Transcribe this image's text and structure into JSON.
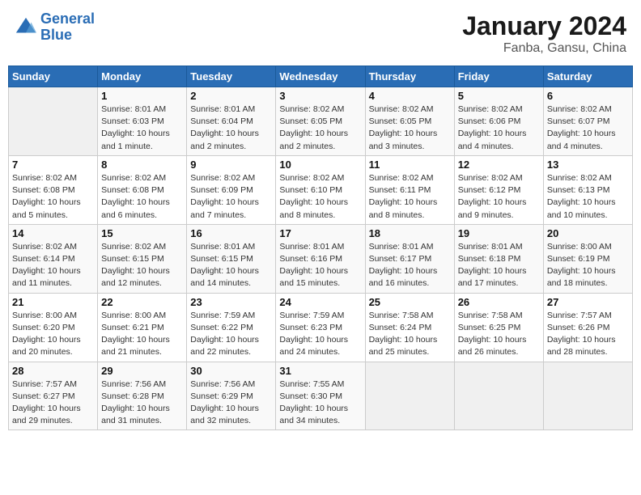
{
  "header": {
    "logo_line1": "General",
    "logo_line2": "Blue",
    "month": "January 2024",
    "location": "Fanba, Gansu, China"
  },
  "weekdays": [
    "Sunday",
    "Monday",
    "Tuesday",
    "Wednesday",
    "Thursday",
    "Friday",
    "Saturday"
  ],
  "weeks": [
    [
      {
        "day": "",
        "sunrise": "",
        "sunset": "",
        "daylight": ""
      },
      {
        "day": "1",
        "sunrise": "Sunrise: 8:01 AM",
        "sunset": "Sunset: 6:03 PM",
        "daylight": "Daylight: 10 hours and 1 minute."
      },
      {
        "day": "2",
        "sunrise": "Sunrise: 8:01 AM",
        "sunset": "Sunset: 6:04 PM",
        "daylight": "Daylight: 10 hours and 2 minutes."
      },
      {
        "day": "3",
        "sunrise": "Sunrise: 8:02 AM",
        "sunset": "Sunset: 6:05 PM",
        "daylight": "Daylight: 10 hours and 2 minutes."
      },
      {
        "day": "4",
        "sunrise": "Sunrise: 8:02 AM",
        "sunset": "Sunset: 6:05 PM",
        "daylight": "Daylight: 10 hours and 3 minutes."
      },
      {
        "day": "5",
        "sunrise": "Sunrise: 8:02 AM",
        "sunset": "Sunset: 6:06 PM",
        "daylight": "Daylight: 10 hours and 4 minutes."
      },
      {
        "day": "6",
        "sunrise": "Sunrise: 8:02 AM",
        "sunset": "Sunset: 6:07 PM",
        "daylight": "Daylight: 10 hours and 4 minutes."
      }
    ],
    [
      {
        "day": "7",
        "sunrise": "Sunrise: 8:02 AM",
        "sunset": "Sunset: 6:08 PM",
        "daylight": "Daylight: 10 hours and 5 minutes."
      },
      {
        "day": "8",
        "sunrise": "Sunrise: 8:02 AM",
        "sunset": "Sunset: 6:08 PM",
        "daylight": "Daylight: 10 hours and 6 minutes."
      },
      {
        "day": "9",
        "sunrise": "Sunrise: 8:02 AM",
        "sunset": "Sunset: 6:09 PM",
        "daylight": "Daylight: 10 hours and 7 minutes."
      },
      {
        "day": "10",
        "sunrise": "Sunrise: 8:02 AM",
        "sunset": "Sunset: 6:10 PM",
        "daylight": "Daylight: 10 hours and 8 minutes."
      },
      {
        "day": "11",
        "sunrise": "Sunrise: 8:02 AM",
        "sunset": "Sunset: 6:11 PM",
        "daylight": "Daylight: 10 hours and 8 minutes."
      },
      {
        "day": "12",
        "sunrise": "Sunrise: 8:02 AM",
        "sunset": "Sunset: 6:12 PM",
        "daylight": "Daylight: 10 hours and 9 minutes."
      },
      {
        "day": "13",
        "sunrise": "Sunrise: 8:02 AM",
        "sunset": "Sunset: 6:13 PM",
        "daylight": "Daylight: 10 hours and 10 minutes."
      }
    ],
    [
      {
        "day": "14",
        "sunrise": "Sunrise: 8:02 AM",
        "sunset": "Sunset: 6:14 PM",
        "daylight": "Daylight: 10 hours and 11 minutes."
      },
      {
        "day": "15",
        "sunrise": "Sunrise: 8:02 AM",
        "sunset": "Sunset: 6:15 PM",
        "daylight": "Daylight: 10 hours and 12 minutes."
      },
      {
        "day": "16",
        "sunrise": "Sunrise: 8:01 AM",
        "sunset": "Sunset: 6:15 PM",
        "daylight": "Daylight: 10 hours and 14 minutes."
      },
      {
        "day": "17",
        "sunrise": "Sunrise: 8:01 AM",
        "sunset": "Sunset: 6:16 PM",
        "daylight": "Daylight: 10 hours and 15 minutes."
      },
      {
        "day": "18",
        "sunrise": "Sunrise: 8:01 AM",
        "sunset": "Sunset: 6:17 PM",
        "daylight": "Daylight: 10 hours and 16 minutes."
      },
      {
        "day": "19",
        "sunrise": "Sunrise: 8:01 AM",
        "sunset": "Sunset: 6:18 PM",
        "daylight": "Daylight: 10 hours and 17 minutes."
      },
      {
        "day": "20",
        "sunrise": "Sunrise: 8:00 AM",
        "sunset": "Sunset: 6:19 PM",
        "daylight": "Daylight: 10 hours and 18 minutes."
      }
    ],
    [
      {
        "day": "21",
        "sunrise": "Sunrise: 8:00 AM",
        "sunset": "Sunset: 6:20 PM",
        "daylight": "Daylight: 10 hours and 20 minutes."
      },
      {
        "day": "22",
        "sunrise": "Sunrise: 8:00 AM",
        "sunset": "Sunset: 6:21 PM",
        "daylight": "Daylight: 10 hours and 21 minutes."
      },
      {
        "day": "23",
        "sunrise": "Sunrise: 7:59 AM",
        "sunset": "Sunset: 6:22 PM",
        "daylight": "Daylight: 10 hours and 22 minutes."
      },
      {
        "day": "24",
        "sunrise": "Sunrise: 7:59 AM",
        "sunset": "Sunset: 6:23 PM",
        "daylight": "Daylight: 10 hours and 24 minutes."
      },
      {
        "day": "25",
        "sunrise": "Sunrise: 7:58 AM",
        "sunset": "Sunset: 6:24 PM",
        "daylight": "Daylight: 10 hours and 25 minutes."
      },
      {
        "day": "26",
        "sunrise": "Sunrise: 7:58 AM",
        "sunset": "Sunset: 6:25 PM",
        "daylight": "Daylight: 10 hours and 26 minutes."
      },
      {
        "day": "27",
        "sunrise": "Sunrise: 7:57 AM",
        "sunset": "Sunset: 6:26 PM",
        "daylight": "Daylight: 10 hours and 28 minutes."
      }
    ],
    [
      {
        "day": "28",
        "sunrise": "Sunrise: 7:57 AM",
        "sunset": "Sunset: 6:27 PM",
        "daylight": "Daylight: 10 hours and 29 minutes."
      },
      {
        "day": "29",
        "sunrise": "Sunrise: 7:56 AM",
        "sunset": "Sunset: 6:28 PM",
        "daylight": "Daylight: 10 hours and 31 minutes."
      },
      {
        "day": "30",
        "sunrise": "Sunrise: 7:56 AM",
        "sunset": "Sunset: 6:29 PM",
        "daylight": "Daylight: 10 hours and 32 minutes."
      },
      {
        "day": "31",
        "sunrise": "Sunrise: 7:55 AM",
        "sunset": "Sunset: 6:30 PM",
        "daylight": "Daylight: 10 hours and 34 minutes."
      },
      {
        "day": "",
        "sunrise": "",
        "sunset": "",
        "daylight": ""
      },
      {
        "day": "",
        "sunrise": "",
        "sunset": "",
        "daylight": ""
      },
      {
        "day": "",
        "sunrise": "",
        "sunset": "",
        "daylight": ""
      }
    ]
  ]
}
